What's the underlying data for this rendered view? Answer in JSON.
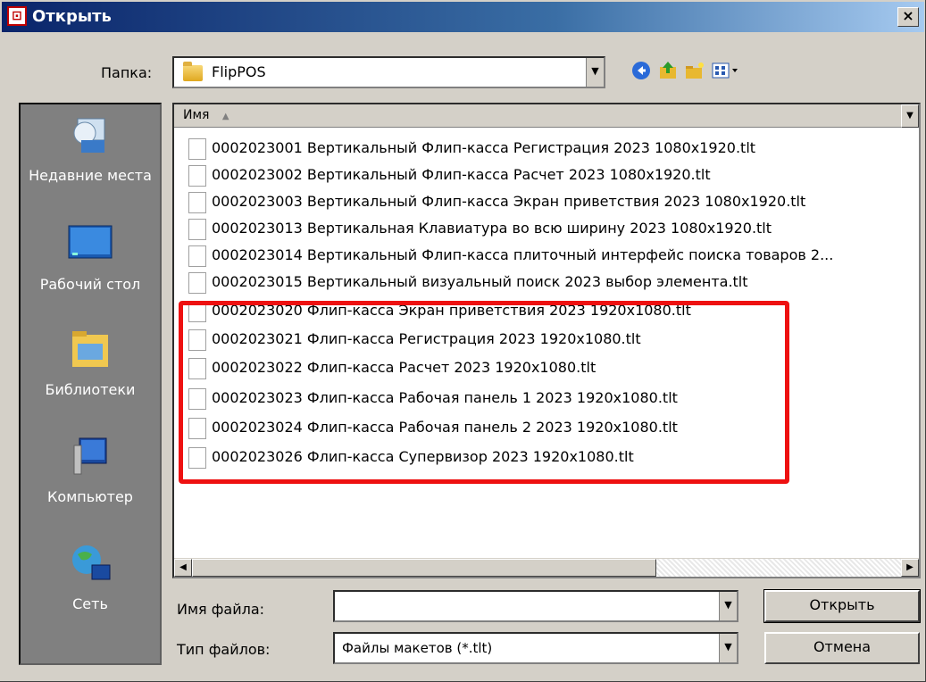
{
  "dialog": {
    "title": "Открыть",
    "close_label": "×"
  },
  "location": {
    "label": "Папка:",
    "value": "FlipPOS"
  },
  "toolbar": {
    "back": "back-icon",
    "up": "up-folder-icon",
    "new_folder": "new-folder-icon",
    "view": "view-menu-icon"
  },
  "places": [
    {
      "label": "Недавние места"
    },
    {
      "label": "Рабочий стол"
    },
    {
      "label": "Библиотеки"
    },
    {
      "label": "Компьютер"
    },
    {
      "label": "Сеть"
    }
  ],
  "filelist": {
    "column": "Имя",
    "files": [
      "0002023001 Вертикальный Флип-касса Регистрация 2023 1080x1920.tlt",
      "0002023002 Вертикальный Флип-касса Расчет 2023 1080x1920.tlt",
      "0002023003 Вертикальный Флип-касса Экран приветствия 2023 1080x1920.tlt",
      "0002023013 Вертикальная Клавиатура во всю ширину 2023 1080x1920.tlt",
      "0002023014 Вертикальный Флип-касса плиточный интерфейс поиска товаров 2...",
      "0002023015 Вертикальный визуальный поиск 2023 выбор элемента.tlt",
      "0002023020 Флип-касса Экран приветствия 2023 1920x1080.tlt",
      "0002023021 Флип-касса Регистрация 2023 1920x1080.tlt",
      "0002023022 Флип-касса Расчет 2023 1920x1080.tlt",
      "0002023023 Флип-касса Рабочая панель 1 2023 1920x1080.tlt",
      "0002023024 Флип-касса Рабочая панель 2 2023 1920x1080.tlt",
      "0002023026 Флип-касса Супервизор 2023 1920x1080.tlt"
    ]
  },
  "filename": {
    "label": "Имя файла:",
    "value": ""
  },
  "filetype": {
    "label": "Тип файлов:",
    "value": "Файлы макетов (*.tlt)"
  },
  "buttons": {
    "open": "Открыть",
    "cancel": "Отмена"
  },
  "colors": {
    "highlight": "#ee1111",
    "titlebar": "#0a246a"
  }
}
